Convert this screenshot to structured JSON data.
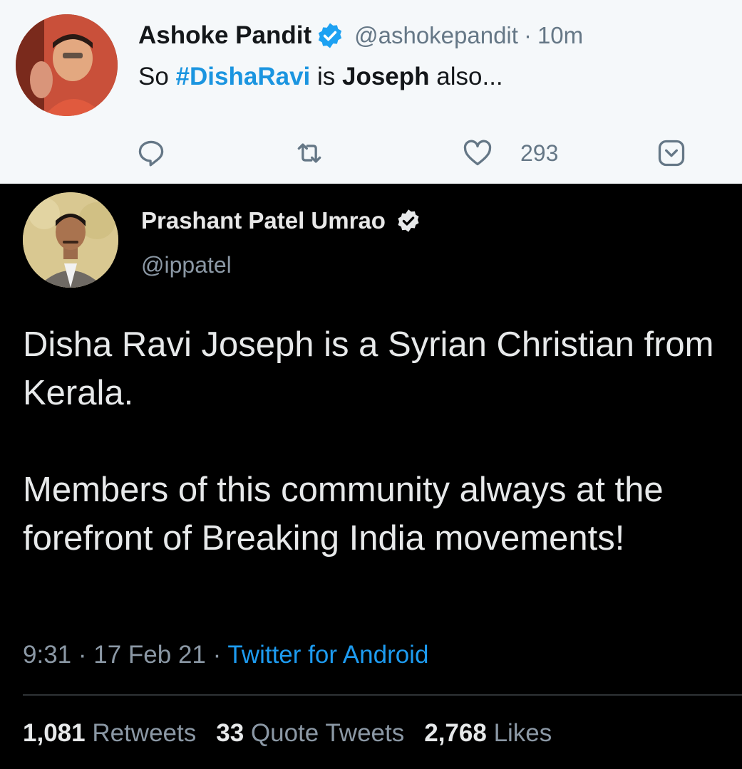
{
  "tweet": {
    "author_name": "Ashoke Pandit",
    "handle": "@ashokepandit",
    "separator": "·",
    "time": "10m",
    "text_prefix": "So ",
    "hashtag": "#DishaRavi",
    "text_mid": " is ",
    "text_bold": "Joseph",
    "text_suffix": " also...",
    "like_count": "293",
    "icons": [
      "reply-icon",
      "retweet-icon",
      "heart-icon",
      "chevron-down-icon",
      "verified-badge-icon"
    ]
  },
  "quoted": {
    "author_name": "Prashant Patel Umrao",
    "handle": "@ippatel",
    "paragraphs": [
      "Disha Ravi Joseph is a Syrian Christian from Kerala.",
      "Members of this community always at the forefront of Breaking India movements!"
    ],
    "time": "9:31",
    "date": "17 Feb 21",
    "source": "Twitter for Android",
    "sep": "·",
    "stats": {
      "retweets_count": "1,081",
      "retweets_label": "Retweets",
      "quotes_count": "33",
      "quotes_label": "Quote Tweets",
      "likes_count": "2,768",
      "likes_label": "Likes"
    }
  },
  "colors": {
    "link_blue": "#1b95e0",
    "dark_bg": "#000000",
    "light_bg": "#f5f8fa"
  }
}
